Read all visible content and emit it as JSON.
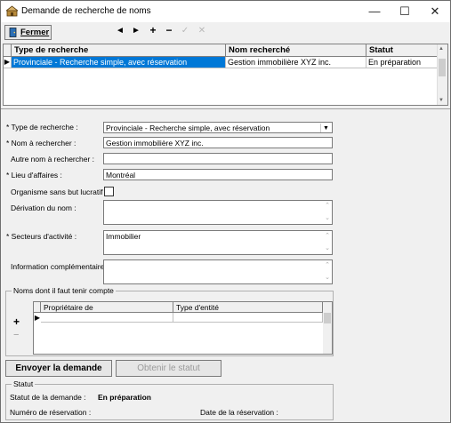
{
  "window": {
    "title": "Demande de recherche de noms",
    "minimize_glyph": "—",
    "maximize_glyph": "☐",
    "close_glyph": "✕"
  },
  "toolbar": {
    "close_label": "Fermer",
    "icons": {
      "prev": "◄",
      "next": "►",
      "add": "+",
      "remove": "−",
      "confirm": "✓",
      "cancel": "✕"
    }
  },
  "grid": {
    "columns": [
      "Type de recherche",
      "Nom recherché",
      "Statut"
    ],
    "rows": [
      {
        "type": "Provinciale - Recherche simple, avec réservation",
        "name": "Gestion immobilière XYZ inc.",
        "status": "En préparation"
      }
    ]
  },
  "form": {
    "type_label": "* Type de recherche :",
    "type_value": "Provinciale - Recherche simple, avec réservation",
    "name_label": "* Nom à rechercher :",
    "name_value": "Gestion immobilière XYZ inc.",
    "other_name_label": "Autre nom à rechercher :",
    "other_name_value": "",
    "place_label": "* Lieu d'affaires :",
    "place_value": "Montréal",
    "nonprofit_label": "Organisme sans but lucratif",
    "derivation_label": "Dérivation du nom :",
    "derivation_value": "",
    "sectors_label": "* Secteurs d'activité :",
    "sectors_value": "Immobilier",
    "info_label": "Information complémentaire :",
    "info_value": ""
  },
  "names_group": {
    "title": "Noms dont il faut tenir compte",
    "columns": [
      "Propriétaire de",
      "Type d'entité"
    ],
    "add_icon": "+",
    "remove_icon": "−"
  },
  "actions": {
    "send": "Envoyer la demande",
    "get_status": "Obtenir le statut"
  },
  "status_group": {
    "title": "Statut",
    "request_status_label": "Statut de la demande :",
    "request_status_value": "En préparation",
    "reservation_number_label": "Numéro de réservation :",
    "reservation_date_label": "Date de la réservation :"
  },
  "colors": {
    "selection": "#0078d7",
    "background": "#f0f0f0"
  }
}
